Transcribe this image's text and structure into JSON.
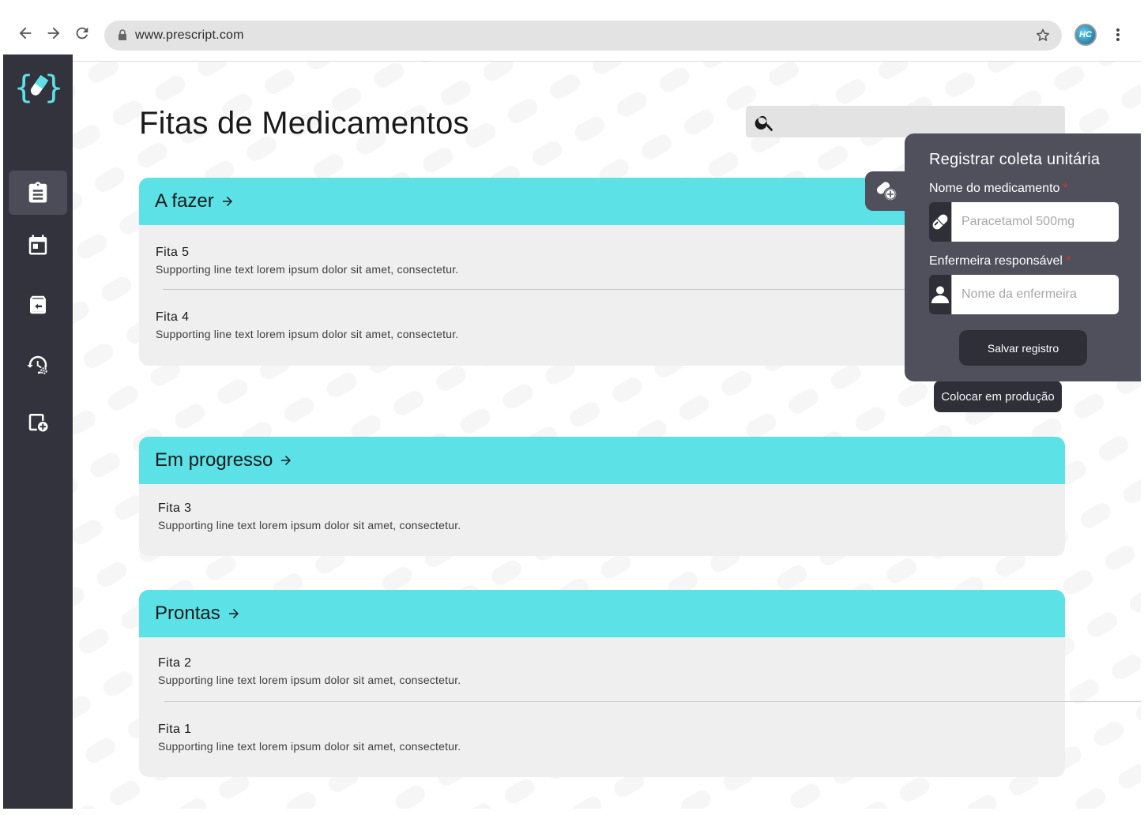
{
  "browser": {
    "url": "www.prescript.com",
    "profile_initials": "HC"
  },
  "sidebar": {
    "items": [
      {
        "name": "clipboard-icon",
        "active": true
      },
      {
        "name": "calendar-icon",
        "active": false
      },
      {
        "name": "archive-return-icon",
        "active": false
      },
      {
        "name": "history-settings-icon",
        "active": false
      },
      {
        "name": "add-document-icon",
        "active": false
      }
    ]
  },
  "main": {
    "title": "Fitas de Medicamentos",
    "sections": [
      {
        "label": "A fazer",
        "items": [
          {
            "title": "Fita 5",
            "subtitle": "Supporting line text lorem ipsum dolor sit amet, consectetur."
          },
          {
            "title": "Fita 4",
            "subtitle": "Supporting line text lorem ipsum dolor sit amet, consectetur."
          }
        ]
      },
      {
        "label": "Em progresso",
        "items": [
          {
            "title": "Fita 3",
            "subtitle": "Supporting line text lorem ipsum dolor sit amet, consectetur."
          }
        ]
      },
      {
        "label": "Prontas",
        "items": [
          {
            "title": "Fita 2",
            "subtitle": "Supporting line text lorem ipsum dolor sit amet, consectetur."
          },
          {
            "title": "Fita 1",
            "subtitle": "Supporting line text lorem ipsum dolor sit amet, consectetur."
          }
        ]
      }
    ],
    "tooltip": "Colocar em produção"
  },
  "popover": {
    "title": "Registrar coleta unitária",
    "medicine_label": "Nome do medicamento",
    "medicine_placeholder": "Paracetamol 500mg",
    "nurse_label": "Enfermeira responsável",
    "nurse_placeholder": "Nome da enfermeira",
    "required_mark": "*",
    "save_label": "Salvar registro"
  },
  "colors": {
    "accent": "#5ce1e6",
    "sidebar": "#33333d",
    "popover": "#50505d",
    "dark_button": "#2f2f38",
    "card": "#efefef",
    "required": "#e0302a"
  }
}
